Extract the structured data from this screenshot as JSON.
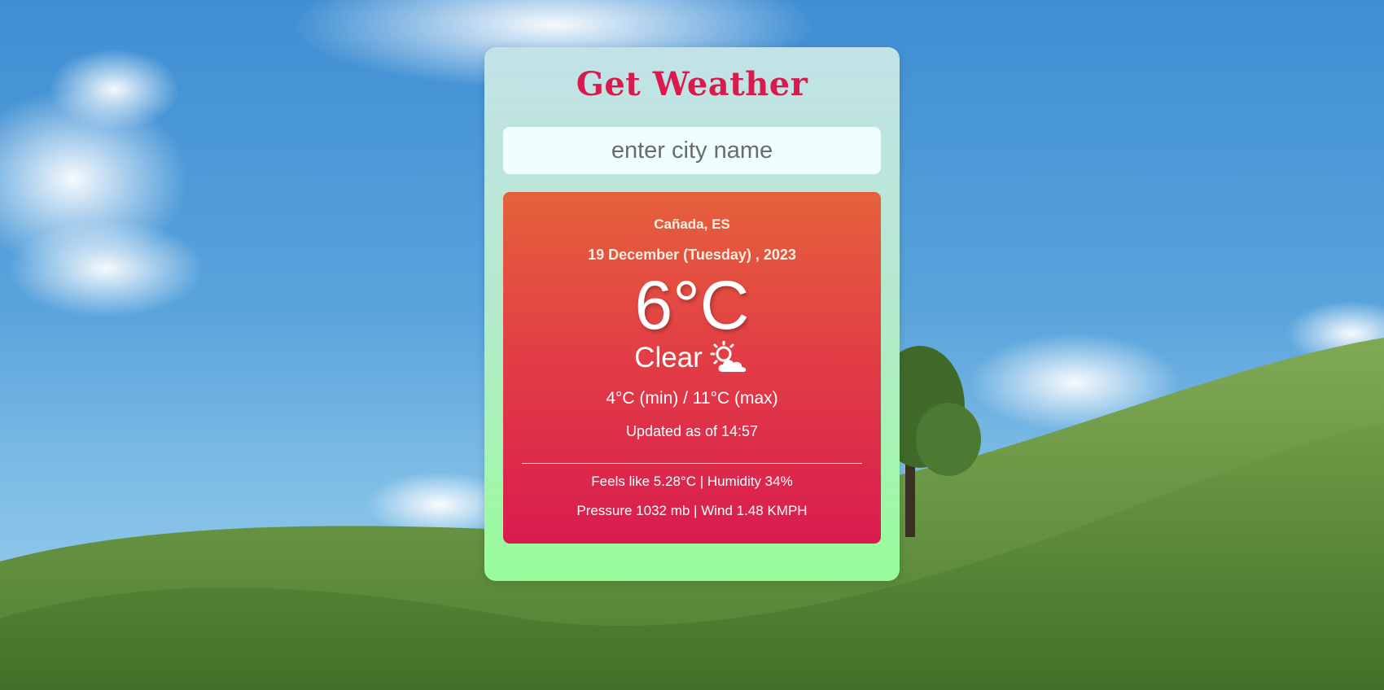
{
  "app": {
    "title": "Get Weather"
  },
  "search": {
    "placeholder": "enter city name",
    "value": ""
  },
  "weather": {
    "location": "Cañada, ES",
    "date": "19 December (Tuesday) , 2023",
    "temperature": "6°C",
    "condition": "Clear",
    "condition_icon": "sun-behind-cloud-icon",
    "min_max": "4°C (min) / 11°C (max)",
    "updated": "Updated as of 14:57",
    "feels_humidity": "Feels like 5.28°C | Humidity 34%",
    "pressure_wind": "Pressure 1032 mb | Wind 1.48 KMPH"
  },
  "colors": {
    "title": "#d81a4c",
    "card_top": "#c2e2e8",
    "card_bottom": "#98fd9a",
    "panel_top": "#e5613b",
    "panel_bottom": "#d91c4f",
    "input_bg": "#effffd"
  }
}
